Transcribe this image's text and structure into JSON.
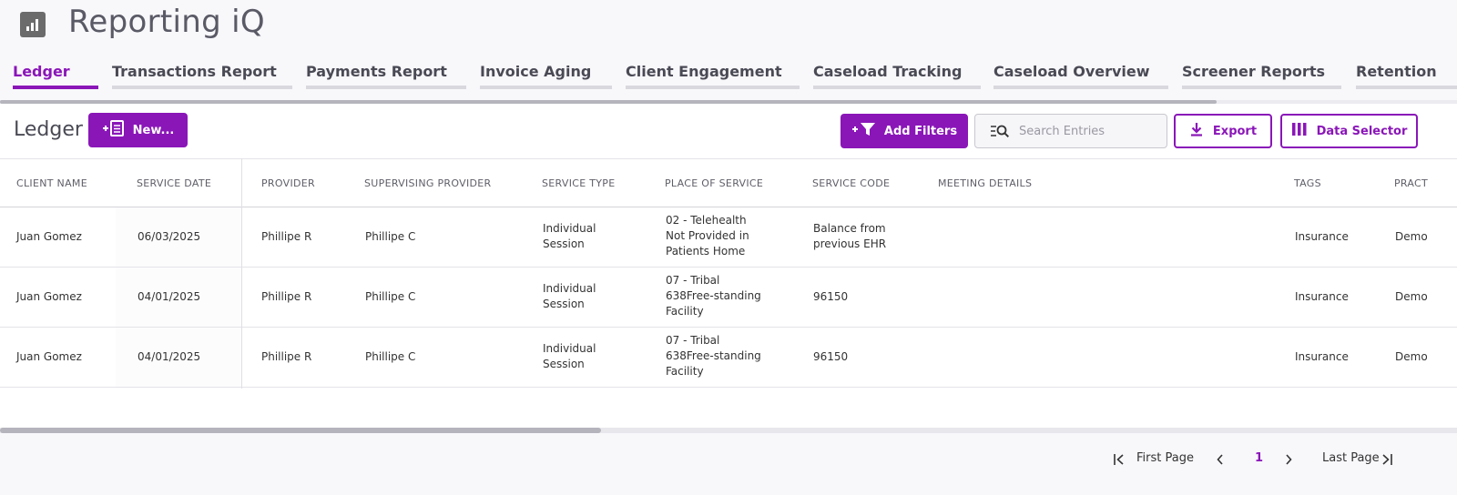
{
  "app": {
    "title": "Reporting iQ",
    "icon": "bar-chart-icon"
  },
  "tabs": [
    {
      "label": "Ledger",
      "active": true
    },
    {
      "label": "Transactions Report",
      "active": false
    },
    {
      "label": "Payments Report",
      "active": false
    },
    {
      "label": "Invoice Aging",
      "active": false
    },
    {
      "label": "Client Engagement",
      "active": false
    },
    {
      "label": "Caseload Tracking",
      "active": false
    },
    {
      "label": "Caseload Overview",
      "active": false
    },
    {
      "label": "Screener Reports",
      "active": false
    },
    {
      "label": "Retention",
      "active": false
    }
  ],
  "toolbar": {
    "title": "Ledger",
    "new_label": "New...",
    "add_filters_label": "Add Filters",
    "search_placeholder": "Search Entries",
    "export_label": "Export",
    "data_selector_label": "Data Selector"
  },
  "table": {
    "columns": [
      "CLIENT NAME",
      "SERVICE DATE",
      "PROVIDER",
      "SUPERVISING PROVIDER",
      "SERVICE TYPE",
      "PLACE OF SERVICE",
      "SERVICE CODE",
      "MEETING DETAILS",
      "TAGS",
      "PRACT"
    ],
    "rows": [
      {
        "client_name": "Juan Gomez",
        "service_date": "06/03/2025",
        "provider": "Phillipe R",
        "supervising_provider": "Phillipe C",
        "service_type": [
          "Individual",
          "Session"
        ],
        "place_of_service": [
          "02 - Telehealth",
          "Not Provided in",
          "Patients Home"
        ],
        "service_code": [
          "Balance from",
          "previous EHR"
        ],
        "meeting_details": "",
        "tags": "Insurance",
        "practice": "Demo"
      },
      {
        "client_name": "Juan Gomez",
        "service_date": "04/01/2025",
        "provider": "Phillipe R",
        "supervising_provider": "Phillipe C",
        "service_type": [
          "Individual",
          "Session"
        ],
        "place_of_service": [
          "07 - Tribal",
          "638Free-standing",
          "Facility"
        ],
        "service_code": [
          "96150"
        ],
        "meeting_details": "",
        "tags": "Insurance",
        "practice": "Demo"
      },
      {
        "client_name": "Juan Gomez",
        "service_date": "04/01/2025",
        "provider": "Phillipe R",
        "supervising_provider": "Phillipe C",
        "service_type": [
          "Individual",
          "Session"
        ],
        "place_of_service": [
          "07 - Tribal",
          "638Free-standing",
          "Facility"
        ],
        "service_code": [
          "96150"
        ],
        "meeting_details": "",
        "tags": "Insurance",
        "practice": "Demo"
      }
    ]
  },
  "pagination": {
    "first_label": "First Page",
    "current_page": "1",
    "last_label": "Last Page"
  },
  "colors": {
    "accent": "#8a16b8",
    "tab_inactive": "#d9d8de",
    "background": "#f8f7fa"
  }
}
